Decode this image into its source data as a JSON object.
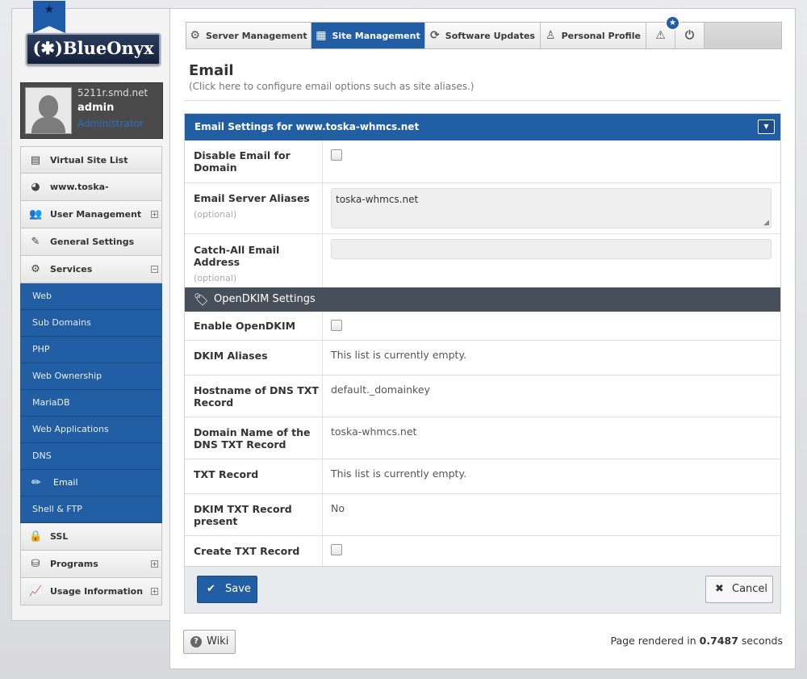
{
  "logo": {
    "text": "(✱)BlueOnyx",
    "ribbon_icon": "star-icon"
  },
  "user": {
    "host": "5211r.smd.net",
    "name": "admin",
    "role": "Administrator"
  },
  "nav": {
    "items": [
      {
        "label": "Virtual Site List",
        "icon": "list-icon"
      },
      {
        "label": "www.toska-whmcs.net",
        "icon": "globe-icon"
      },
      {
        "label": "User Management",
        "icon": "users-icon",
        "expand": "+"
      },
      {
        "label": "General Settings",
        "icon": "edit-icon"
      },
      {
        "label": "Services",
        "icon": "gear-icon",
        "expand": "−"
      }
    ],
    "sub_items": [
      {
        "label": "Web"
      },
      {
        "label": "Sub Domains"
      },
      {
        "label": "PHP"
      },
      {
        "label": "Web Ownership"
      },
      {
        "label": "MariaDB"
      },
      {
        "label": "Web Applications"
      },
      {
        "label": "DNS"
      },
      {
        "label": "Email",
        "active": true
      },
      {
        "label": "Shell & FTP"
      }
    ],
    "items_after": [
      {
        "label": "SSL",
        "icon": "lock-icon"
      },
      {
        "label": "Programs",
        "icon": "programs-icon",
        "expand": "+"
      },
      {
        "label": "Usage Information",
        "icon": "chart-icon",
        "expand": "+"
      }
    ]
  },
  "tabs": [
    {
      "label": "Server Management"
    },
    {
      "label": "Site Management",
      "active": true
    },
    {
      "label": "Software Updates"
    },
    {
      "label": "Personal Profile"
    }
  ],
  "notification_badge": "★",
  "page": {
    "title": "Email",
    "subtitle": "(Click here to configure email options such as site aliases.)"
  },
  "form": {
    "header": "Email Settings for www.toska-whmcs.net",
    "disable_email_label": "Disable Email for Domain",
    "aliases_label": "Email Server Aliases",
    "aliases_optional": "(optional)",
    "aliases_value": "toska-whmcs.net",
    "catchall_label": "Catch-All Email Address",
    "catchall_optional": "(optional)",
    "dkim_section": "OpenDKIM Settings",
    "enable_dkim_label": "Enable OpenDKIM",
    "dkim_aliases_label": "DKIM Aliases",
    "dkim_aliases_value": "This list is currently empty.",
    "hostname_label": "Hostname of DNS TXT Record",
    "hostname_value": "default._domainkey",
    "domain_label": "Domain Name of the DNS TXT Record",
    "domain_value": "toska-whmcs.net",
    "txt_label": "TXT Record",
    "txt_value": "This list is currently empty.",
    "txt_present_label": "DKIM TXT Record present",
    "txt_present_value": "No",
    "create_txt_label": "Create TXT Record",
    "save_label": "Save",
    "cancel_label": "Cancel"
  },
  "footer": {
    "wiki_label": "Wiki",
    "render_prefix": "Page rendered in",
    "render_time": "0.7487",
    "render_suffix": "seconds"
  },
  "colors": {
    "accent": "#215ea3",
    "section_dark": "#474f5a"
  }
}
